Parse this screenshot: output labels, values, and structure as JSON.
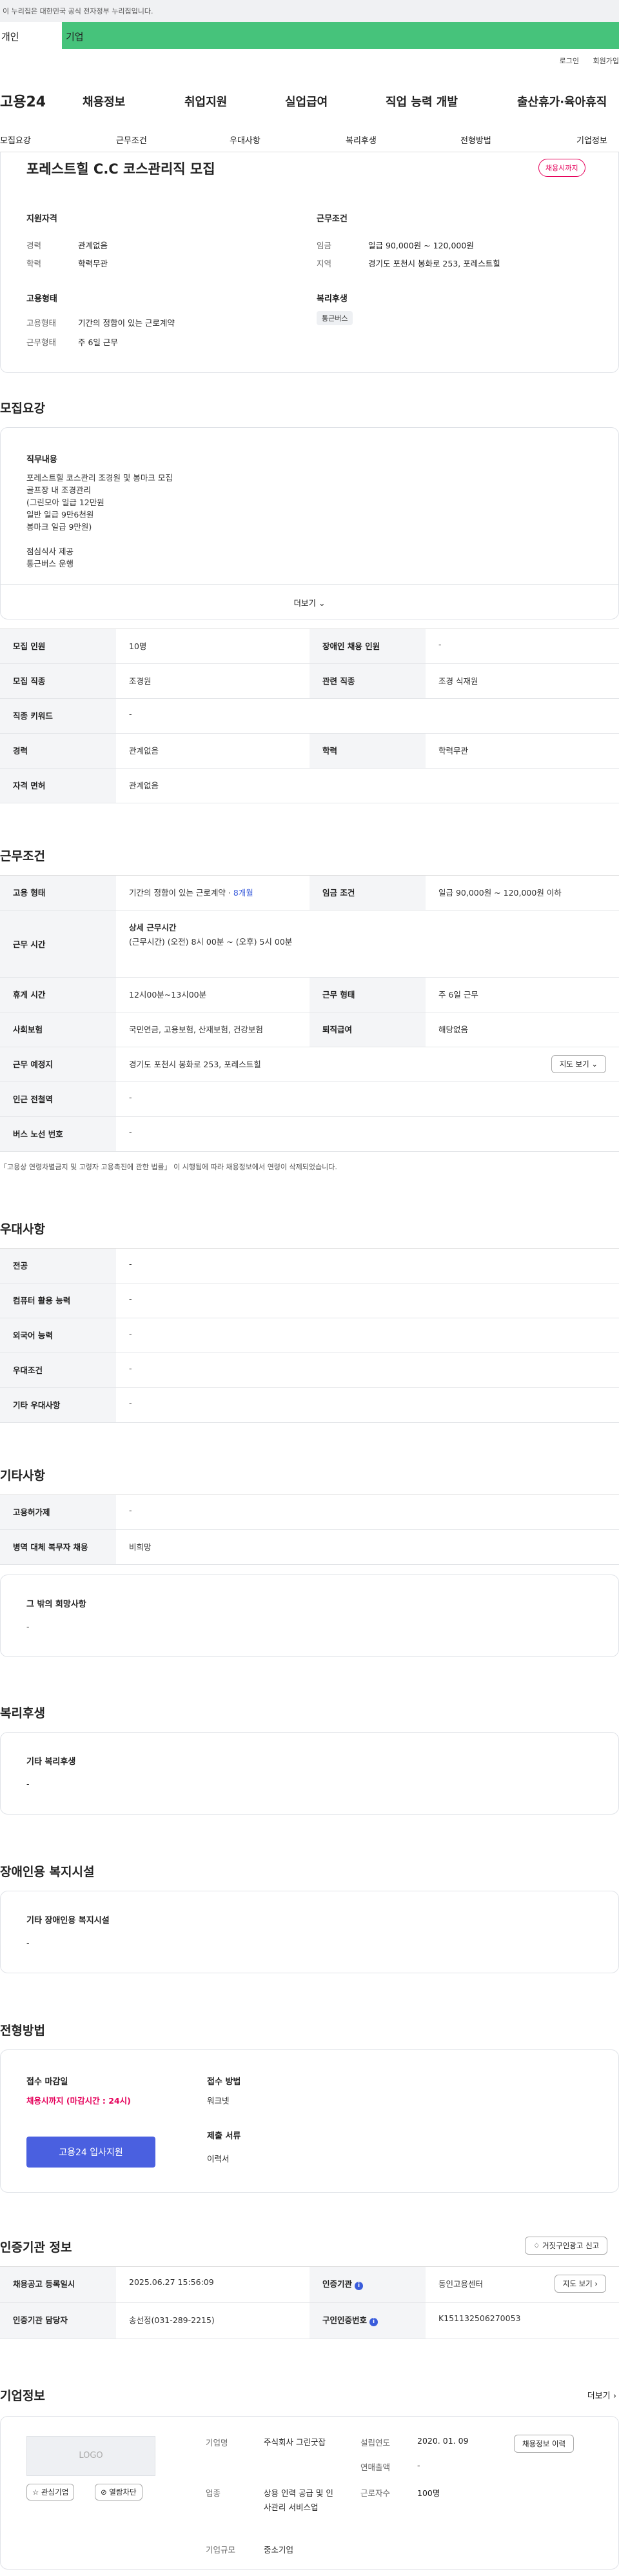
{
  "topbar": {
    "notice": "이 누리집은 대한민국 공식 전자정부 누리집입니다."
  },
  "tabs": {
    "person": "개인",
    "company": "기업"
  },
  "util": {
    "login": "로그인",
    "join": "회원가입"
  },
  "gnb": {
    "logo": "고용24",
    "menu": [
      "채용정보",
      "취업지원",
      "실업급여",
      "직업 능력 개발",
      "출산휴가·육아휴직"
    ]
  },
  "lnb": [
    "모집요강",
    "근무조건",
    "우대사항",
    "복리후생",
    "전형방법",
    "기업정보"
  ],
  "summary": {
    "title": "포레스트힐 C.C 코스관리직 모집",
    "badge": "채용시까지",
    "qual_title": "지원자격",
    "career_k": "경력",
    "career_v": "관계없음",
    "edu_k": "학력",
    "edu_v": "학력무관",
    "cond_title": "근무조건",
    "wage_k": "임금",
    "wage_v": "일급 90,000원 ~ 120,000원",
    "region_k": "지역",
    "region_v": "경기도 포천시 봉화로 253, 포레스트힐",
    "form_title": "고용형태",
    "emp_k": "고용형태",
    "emp_v": "기간의 정함이 있는 근로계약",
    "work_k": "근무형태",
    "work_v": "주 6일 근무",
    "welfare_title": "복리후생",
    "welfare_chip": "통근버스"
  },
  "recruit": {
    "heading": "모집요강",
    "duty_title": "직무내용",
    "duty_lines": [
      "포레스트힐 코스관리 조경원 및 봉마크 모집",
      "골프장 내  조경관리",
      "(그린모아   일급 12만원",
      "일반  일급 9만6천원",
      "봉마크  일급 9만원)",
      "",
      "점심식사 제공",
      "통근버스 운행"
    ],
    "more": "더보기",
    "rows": [
      {
        "k1": "모집 인원",
        "v1": "10명",
        "k2": "장애인 채용 인원",
        "v2": "-"
      },
      {
        "k1": "모집 직종",
        "v1": "조경원",
        "k2": "관련 직종",
        "v2": "조경 식재원"
      },
      {
        "k1": "직종 키워드",
        "v1": "-"
      },
      {
        "k1": "경력",
        "v1": "관계없음",
        "k2": "학력",
        "v2": "학력무관"
      },
      {
        "k1": "자격 면허",
        "v1": "관계없음"
      }
    ]
  },
  "conditions": {
    "heading": "근무조건",
    "emp_k": "고용 형태",
    "emp_v": "기간의 정함이 있는 근로계약 · ",
    "emp_period": "8개월",
    "wage_k": "임금 조건",
    "wage_v": "일급 90,000원 ~ 120,000원 이하",
    "time_k": "근무 시간",
    "time_title": "상세 근무시간",
    "time_v": "(근무시간) (오전) 8시 00분 ~ (오후) 5시 00분",
    "rest_k": "휴게 시간",
    "rest_v": "12시00분~13시00분",
    "wform_k": "근무 형태",
    "wform_v": "주 6일 근무",
    "ins_k": "사회보험",
    "ins_v": "국민연금, 고용보험, 산재보험, 건강보험",
    "ret_k": "퇴직급여",
    "ret_v": "해당없음",
    "place_k": "근무 예정지",
    "place_v": "경기도 포천시 봉화로 253, 포레스트힐",
    "map_btn": "지도 보기",
    "subway_k": "인근 전철역",
    "subway_v": "-",
    "bus_k": "버스 노선 번호",
    "bus_v": "-",
    "note": "「고용상 연령차별금지 및 고령자 고용촉진에 관한 법률」 이 시행됨에 따라 채용정보에서 연령이 삭제되었습니다."
  },
  "preference": {
    "heading": "우대사항",
    "rows": [
      {
        "k": "전공",
        "v": "-"
      },
      {
        "k": "컴퓨터 활용 능력",
        "v": "-"
      },
      {
        "k": "외국어 능력",
        "v": "-"
      },
      {
        "k": "우대조건",
        "v": "-"
      },
      {
        "k": "기타 우대사항",
        "v": "-"
      }
    ]
  },
  "etc": {
    "heading": "기타사항",
    "rows": [
      {
        "k": "고용허가제",
        "v": "-"
      },
      {
        "k": "병역 대체 복무자 채용",
        "v": "비희망"
      }
    ],
    "other_title": "그 밖의 희망사항",
    "other_v": "-"
  },
  "welfare": {
    "heading": "복리후생",
    "title": "기타 복리후생",
    "v": "-"
  },
  "disabled": {
    "heading": "장애인용 복지시설",
    "title": "기타 장애인용 복지시설",
    "v": "-"
  },
  "process": {
    "heading": "전형방법",
    "deadline_k": "접수 마감일",
    "deadline_v": "채용시까지 (마감시간 : 24시)",
    "method_k": "접수 방법",
    "method_v": "워크넷",
    "docs_k": "제출 서류",
    "docs_v": "이력서",
    "apply": "고용24 입사지원"
  },
  "agency": {
    "heading": "인증기관 정보",
    "report_btn": "거짓구인광고 신고",
    "reg_k": "채용공고 등록일시",
    "reg_v": "2025.06.27 15:56:09",
    "org_k": "인증기관",
    "org_v": "동인고용센터",
    "map_btn": "지도 보기",
    "mgr_k": "인증기관 담당자",
    "mgr_v": "송선정(031-289-2215)",
    "num_k": "구인인증번호",
    "num_v": "K151132506270053"
  },
  "company": {
    "heading": "기업정보",
    "more": "더보기",
    "logo": "LOGO",
    "fav": "관심기업",
    "block": "열람차단",
    "name_k": "기업명",
    "name_v": "주식회사 그린굿잡",
    "year_k": "설립연도",
    "year_v": "2020. 01. 09",
    "sales_k": "연매출액",
    "sales_v": "-",
    "ind_k": "업종",
    "ind_v": "상용 인력 공급 및 인사관리 서비스업",
    "emp_k": "근로자수",
    "emp_v": "100명",
    "size_k": "기업규모",
    "size_v": "중소기업",
    "hist_btn": "채용정보 이력"
  }
}
